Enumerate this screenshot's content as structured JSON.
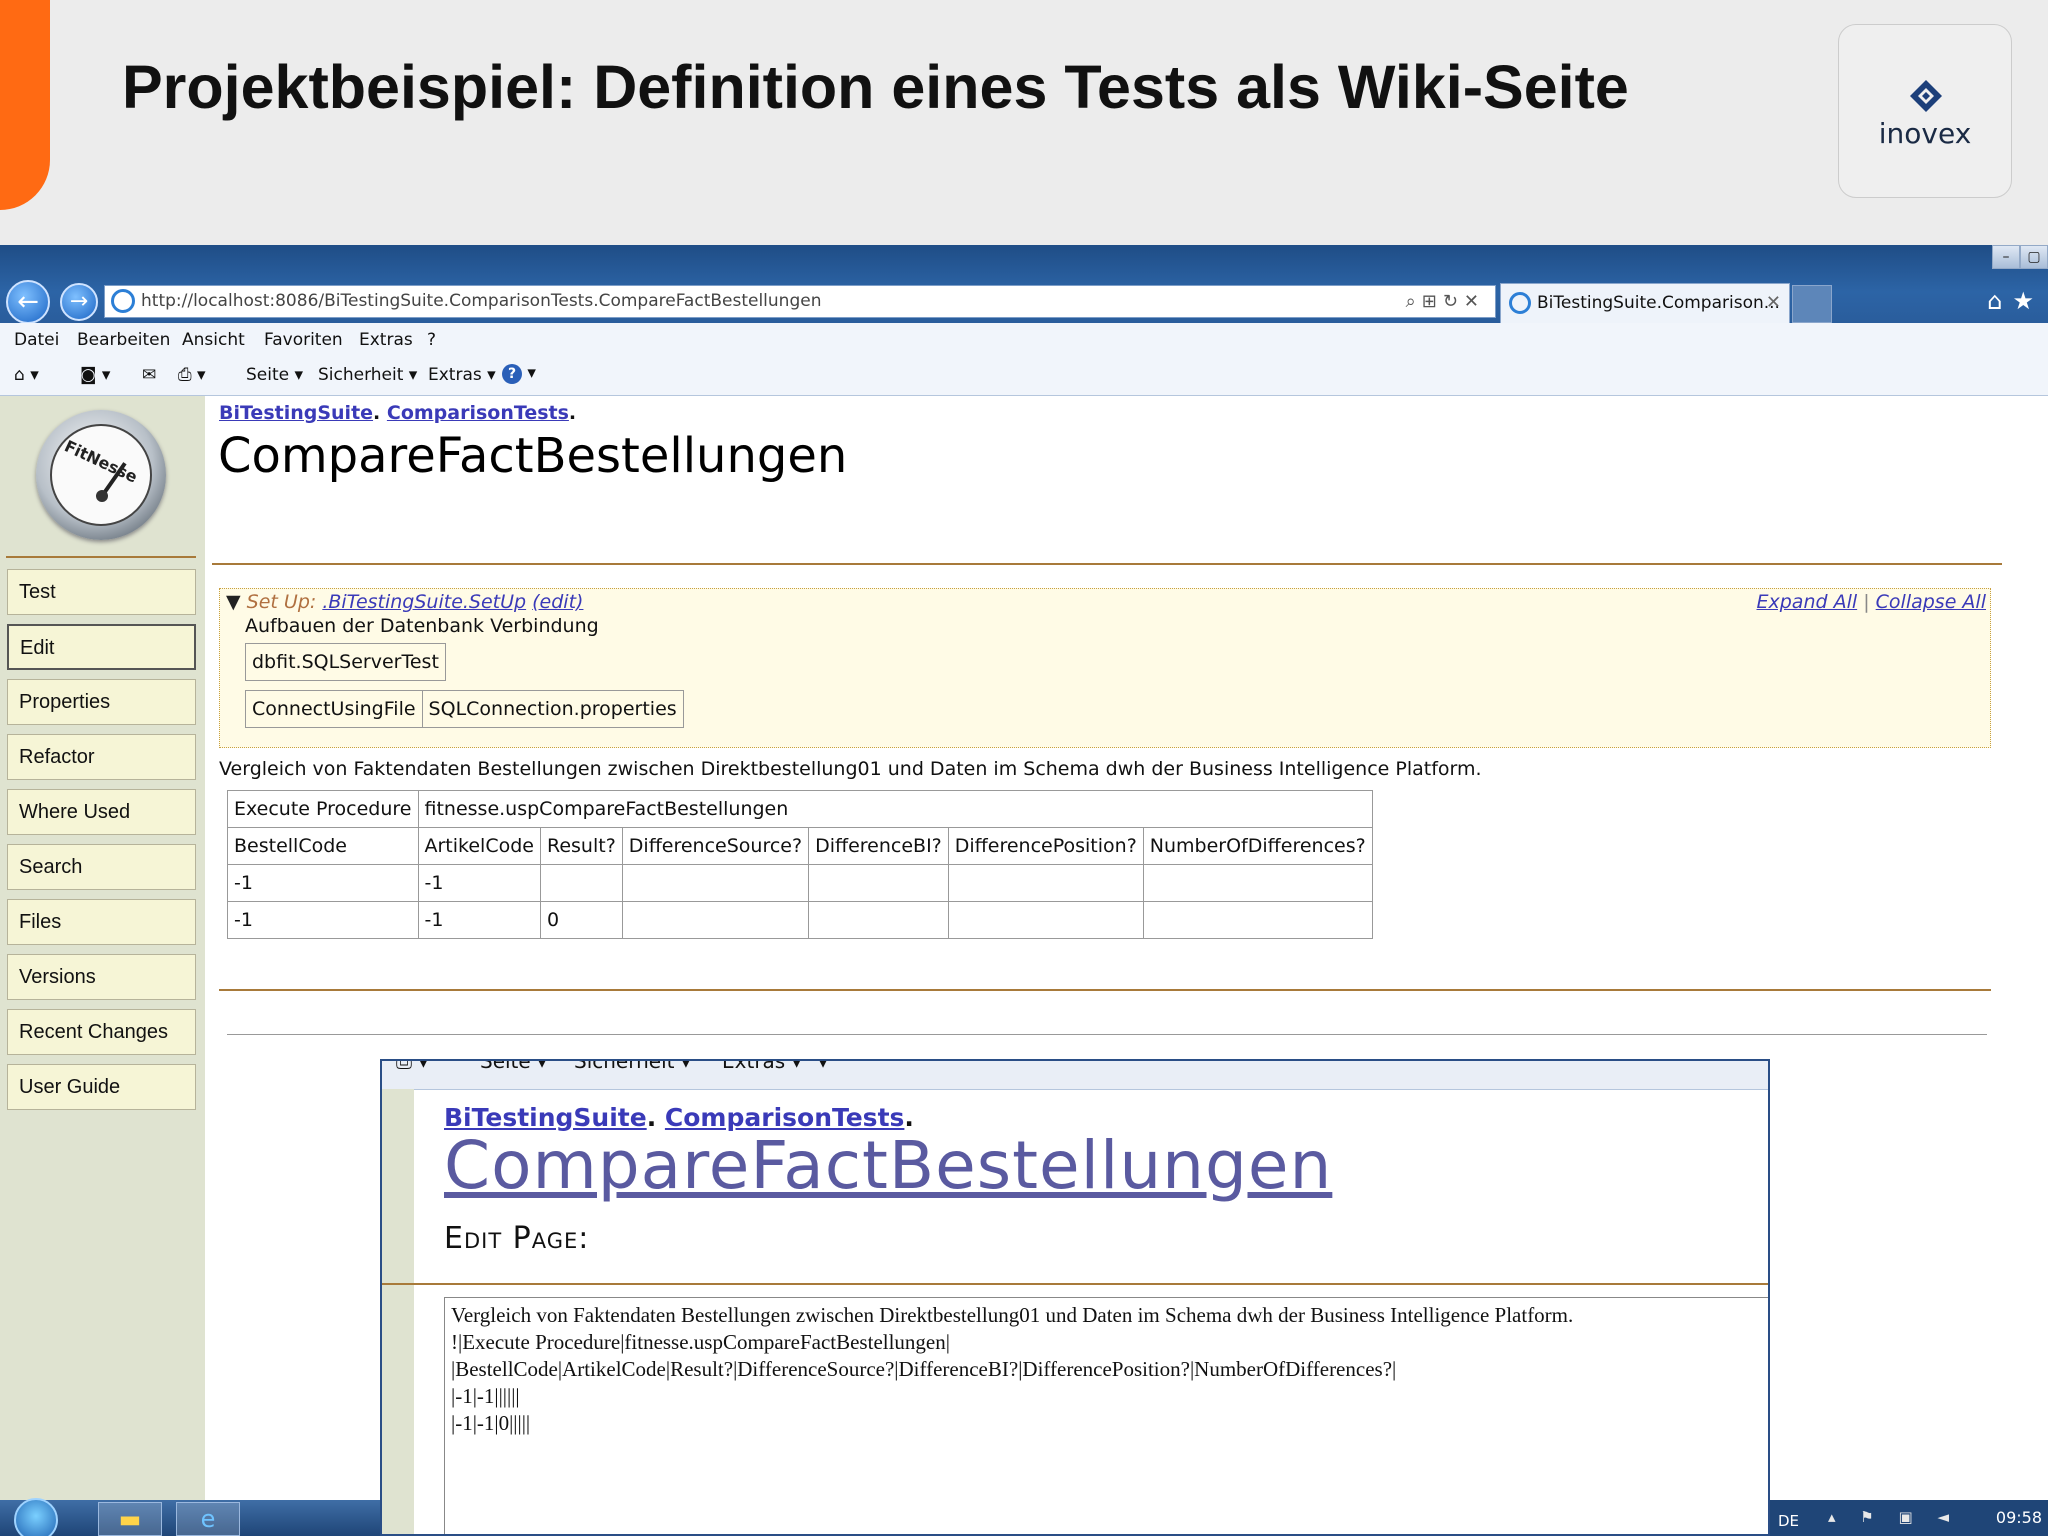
{
  "slide": {
    "title": "Projektbeispiel: Definition eines Tests als Wiki-Seite",
    "logo_text": "inovex"
  },
  "browser": {
    "url": "http://localhost:8086/BiTestingSuite.ComparisonTests.CompareFactBestellungen",
    "tab_title": "BiTestingSuite.Comparison...",
    "menu": [
      "Datei",
      "Bearbeiten",
      "Ansicht",
      "Favoriten",
      "Extras",
      "?"
    ],
    "commands": {
      "page": "Seite ▾",
      "security": "Sicherheit ▾",
      "extras": "Extras ▾"
    }
  },
  "sidebar": {
    "logo_text": "FitNesse",
    "items": [
      "Test",
      "Edit",
      "Properties",
      "Refactor",
      "Where Used",
      "Search",
      "Files",
      "Versions",
      "Recent Changes",
      "User Guide"
    ],
    "active_item": "Edit"
  },
  "page": {
    "breadcrumb": {
      "root": "BiTestingSuite",
      "sep": ".",
      "child": "ComparisonTests",
      "end": "."
    },
    "title": "CompareFactBestellungen",
    "setup": {
      "label": "Set Up:",
      "link": ".BiTestingSuite.SetUp",
      "edit": "(edit)",
      "expand_all": "Expand All",
      "divider": "|",
      "collapse_all": "Collapse All",
      "description": "Aufbauen der Datenbank Verbindung",
      "table1": [
        "dbfit.SQLServerTest"
      ],
      "table2": [
        "ConnectUsingFile",
        "SQLConnection.properties"
      ]
    },
    "description": "Vergleich von Faktendaten Bestellungen zwischen Direktbestellung01 und Daten im Schema dwh der Business Intelligence Platform.",
    "table": {
      "first_row": [
        "Execute Procedure",
        "fitnesse.uspCompareFactBestellungen"
      ],
      "headers": [
        "BestellCode",
        "ArtikelCode",
        "Result?",
        "DifferenceSource?",
        "DifferenceBI?",
        "DifferencePosition?",
        "NumberOfDifferences?"
      ],
      "rows": [
        [
          "-1",
          "-1",
          "",
          "",
          "",
          "",
          ""
        ],
        [
          "-1",
          "-1",
          "0",
          "",
          "",
          "",
          ""
        ]
      ]
    }
  },
  "overlay": {
    "cmd_items": [
      "Seite ▾",
      "Sicherheit ▾",
      "Extras ▾"
    ],
    "breadcrumb": {
      "root": "BiTestingSuite",
      "sep": ".",
      "child": "ComparisonTests",
      "end": "."
    },
    "title": "CompareFactBestellungen",
    "subtitle": "Edit Page:",
    "source_text": "Vergleich von Faktendaten Bestellungen zwischen Direktbestellung01 und Daten im Schema dwh der Business Intelligence Platform.\n!|Execute Procedure|fitnesse.uspCompareFactBestellungen|\n|BestellCode|ArtikelCode|Result?|DifferenceSource?|DifferenceBI?|DifferencePosition?|NumberOfDifferences?|\n|-1|-1||||||\n|-1|-1|0|||||"
  },
  "taskbar": {
    "language": "DE",
    "clock": "09:58"
  }
}
